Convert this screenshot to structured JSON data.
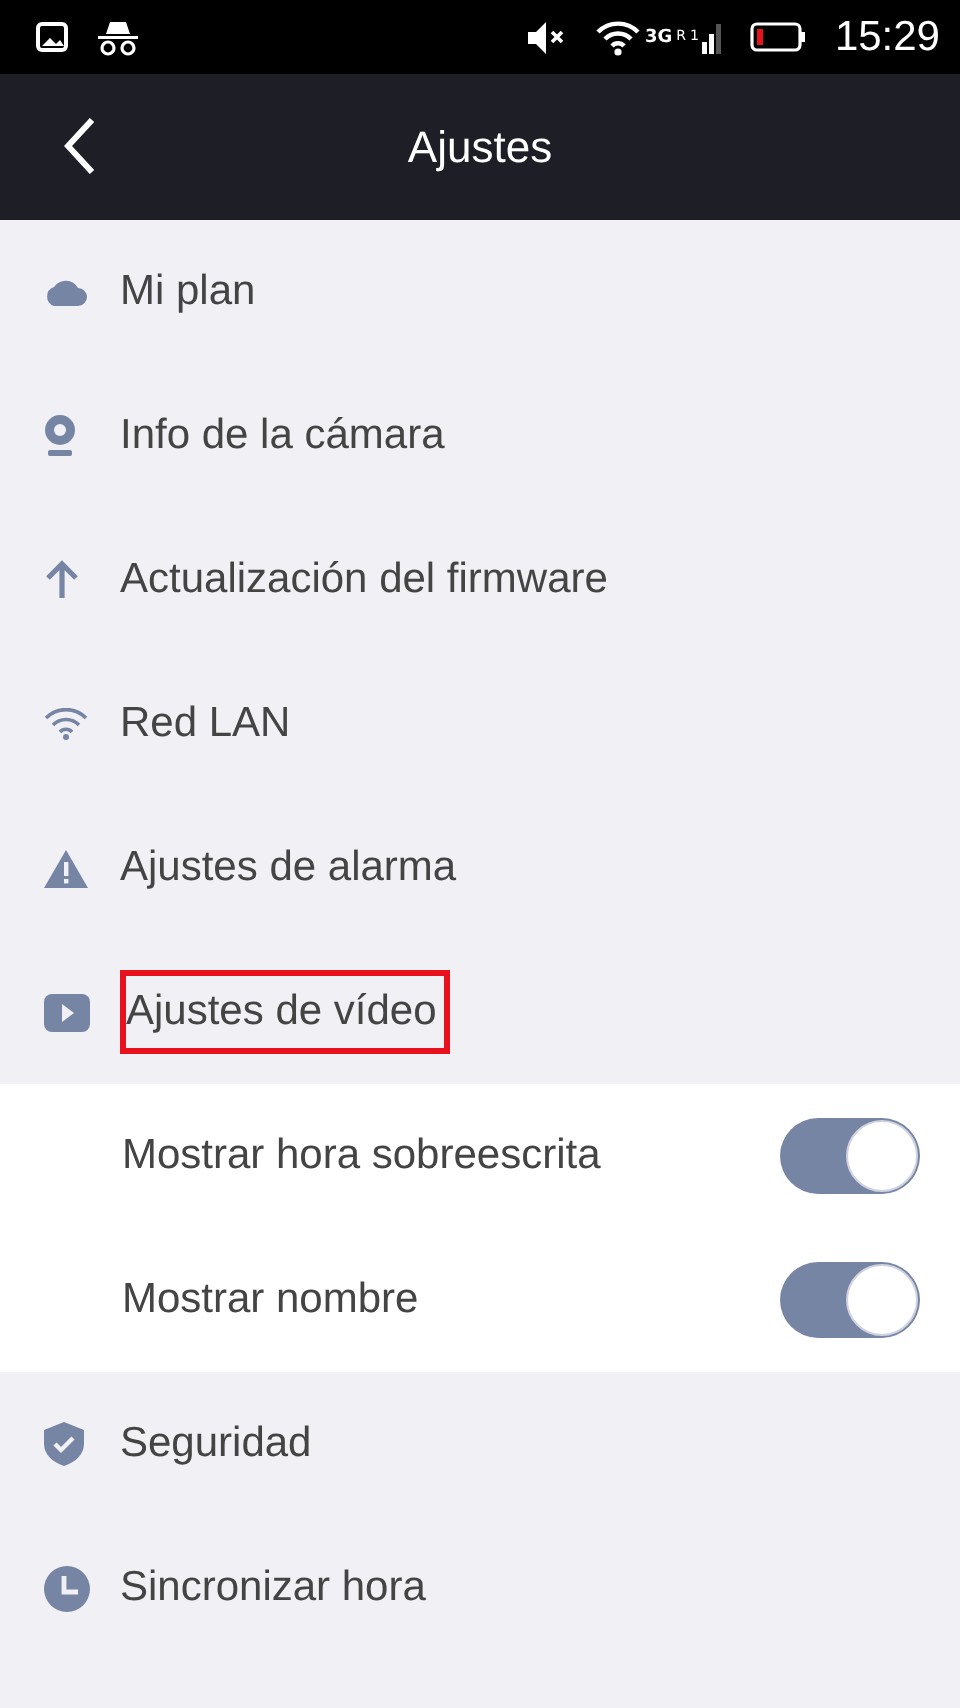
{
  "status_bar": {
    "network": "3G",
    "roaming": "R",
    "sim": "1",
    "time": "15:29"
  },
  "header": {
    "title": "Ajustes"
  },
  "items": [
    {
      "kind": "item",
      "label": "Mi plan",
      "highlighted": false
    },
    {
      "kind": "item",
      "label": "Info de la cámara",
      "highlighted": false
    },
    {
      "kind": "item",
      "label": "Actualización del firmware",
      "highlighted": false
    },
    {
      "kind": "item",
      "label": "Red LAN",
      "highlighted": false
    },
    {
      "kind": "item",
      "label": "Ajustes de alarma",
      "highlighted": false
    },
    {
      "kind": "item",
      "label": "Ajustes de vídeo",
      "highlighted": true
    },
    {
      "kind": "toggle",
      "label": "Mostrar hora sobreescrita",
      "on": true
    },
    {
      "kind": "toggle",
      "label": "Mostrar nombre",
      "on": true
    },
    {
      "kind": "item",
      "label": "Seguridad",
      "highlighted": false
    },
    {
      "kind": "item",
      "label": "Sincronizar hora",
      "highlighted": false
    }
  ]
}
